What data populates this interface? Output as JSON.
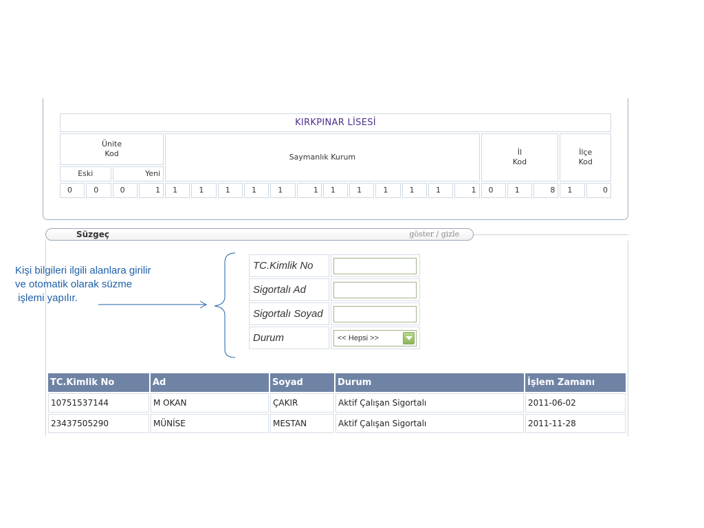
{
  "school": {
    "name": "KIRKPINAR LİSESİ",
    "unite_label_1": "Ünite",
    "unite_label_2": "Kod",
    "eski": "Eski",
    "yeni": "Yeni",
    "saymanlik": "Saymanlık Kurum",
    "il_label_1": "İl",
    "il_label_2": "Kod",
    "ilce_label_1": "İlçe",
    "ilce_label_2": "Kod",
    "eski_digits": [
      "0",
      "0"
    ],
    "yeni_digits": [
      "0",
      "1"
    ],
    "saymanlik_digits": [
      "1",
      "1",
      "1",
      "1",
      "1",
      "1",
      "1",
      "1",
      "1",
      "1",
      "1",
      "1"
    ],
    "il_digits": [
      "0",
      "1",
      "8"
    ],
    "ilce_digits": [
      "1",
      "0"
    ]
  },
  "filter": {
    "title": "Süzgeç",
    "toggle": "göster / gizle",
    "fields": [
      {
        "label": "TC.Kimlik No",
        "value": ""
      },
      {
        "label": "Sigortalı Ad",
        "value": ""
      },
      {
        "label": "Sigortalı Soyad",
        "value": ""
      }
    ],
    "status_label": "Durum",
    "status_value": "<< Hepsi >>"
  },
  "annotation": {
    "line1": "Kişi bilgileri ilgili alanlara girilir",
    "line2": "ve otomatik olarak süzme",
    "line3": " işlemi yapılır."
  },
  "results": {
    "headers": [
      "TC.Kimlik No",
      "Ad",
      "Soyad",
      "Durum",
      "İşlem Zamanı"
    ],
    "rows": [
      [
        "10751537144",
        "M OKAN",
        "ÇAKIR",
        "Aktif Çalışan Sigortalı",
        "2011-06-02"
      ],
      [
        "23437505290",
        "MÜNİSE",
        "MESTAN",
        "Aktif Çalışan Sigortalı",
        "2011-11-28"
      ]
    ]
  },
  "colors": {
    "header_bg": "#6f83a5",
    "annotation": "#1f5fa8",
    "school_name": "#4b2f8c"
  }
}
